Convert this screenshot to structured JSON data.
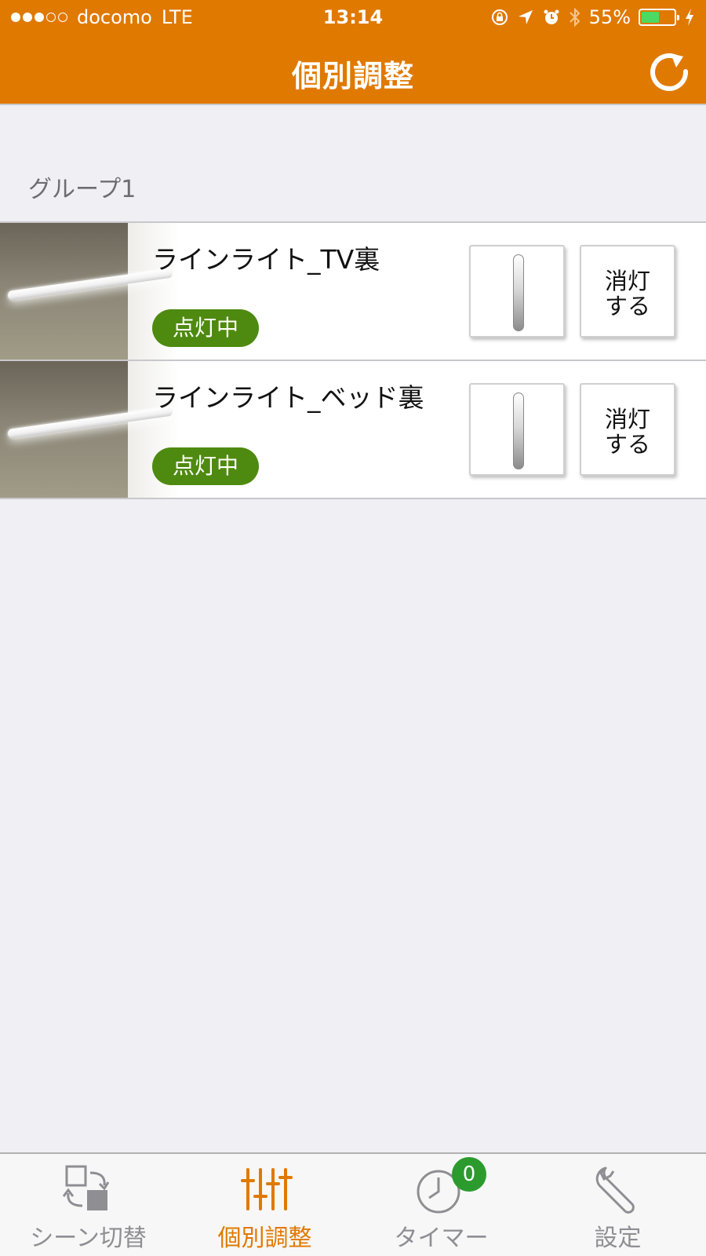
{
  "status_bar": {
    "carrier": "docomo",
    "network": "LTE",
    "time": "13:14",
    "battery": "55%",
    "battery_level": 0.55,
    "signal_bars": 3,
    "signal_total": 5
  },
  "nav": {
    "title": "個別調整",
    "refresh_icon": "refresh-icon"
  },
  "group": {
    "title": "グループ1"
  },
  "devices": [
    {
      "name": "ラインライト_TV裏",
      "status": "点灯中",
      "off_label": [
        "消灯",
        "する"
      ]
    },
    {
      "name": "ラインライト_ベッド裏",
      "status": "点灯中",
      "off_label": [
        "消灯",
        "する"
      ]
    }
  ],
  "tabs": [
    {
      "label": "シーン切替",
      "icon": "scene-switch-icon"
    },
    {
      "label": "個別調整",
      "icon": "sliders-icon",
      "active": true
    },
    {
      "label": "タイマー",
      "icon": "timer-icon",
      "badge": "0"
    },
    {
      "label": "設定",
      "icon": "wrench-icon"
    }
  ],
  "colors": {
    "accent": "#e07900",
    "badge_green": "#4f8a10",
    "timer_badge": "#2b9b2e",
    "battery_green": "#4cd964"
  }
}
